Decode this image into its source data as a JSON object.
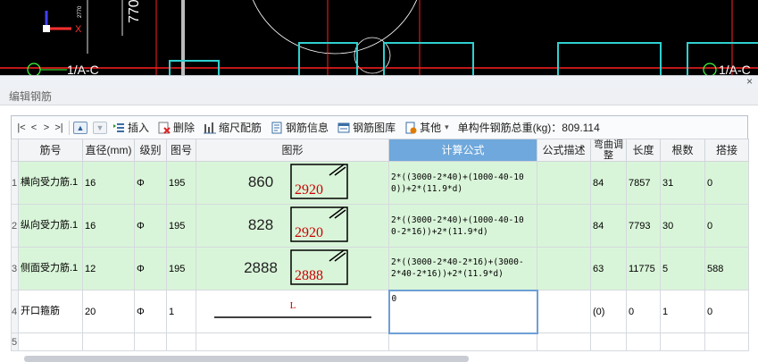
{
  "cad": {
    "axis_label": "1/A-C",
    "axis_label_right": "1/A-C",
    "dim_text": "770",
    "dim_text_small": "2770",
    "x_axis": "X"
  },
  "panel": {
    "title": "编辑钢筋",
    "close": "×"
  },
  "toolbar": {
    "nav": [
      "|<",
      "<",
      ">",
      ">|"
    ],
    "insert": "插入",
    "delete": "删除",
    "scale": "缩尺配筋",
    "info": "钢筋信息",
    "library": "钢筋图库",
    "other": "其他",
    "other_arrow": "▾",
    "total_label": "单构件钢筋总重(kg)：809.114"
  },
  "table": {
    "headers": [
      "",
      "筋号",
      "直径(mm)",
      "级别",
      "图号",
      "图形",
      "计算公式",
      "公式描述",
      "弯曲调整",
      "长度",
      "根数",
      "搭接"
    ],
    "rows": [
      {
        "idx": "1",
        "name": "横向受力筋.1",
        "diameter": "16",
        "grade": "Φ",
        "fig": "195",
        "shape_a": "860",
        "shape_b": "2920",
        "formula": "2*((3000-2*40)+(1000-40-10 0))+2*(11.9*d)",
        "desc": "",
        "bend": "84",
        "length": "7857",
        "count": "31",
        "lap": "0"
      },
      {
        "idx": "2",
        "name": "纵向受力筋.1",
        "diameter": "16",
        "grade": "Φ",
        "fig": "195",
        "shape_a": "828",
        "shape_b": "2920",
        "formula": "2*((3000-2*40)+(1000-40-10 0-2*16))+2*(11.9*d)",
        "desc": "",
        "bend": "84",
        "length": "7793",
        "count": "30",
        "lap": "0"
      },
      {
        "idx": "3",
        "name": "侧面受力筋.1",
        "diameter": "12",
        "grade": "Φ",
        "fig": "195",
        "shape_a": "2888",
        "shape_b": "2888",
        "formula": "2*((3000-2*40-2*16)+(3000-2*40-2*16))+2*(11.9*d)",
        "desc": "",
        "bend": "63",
        "length": "11775",
        "count": "5",
        "lap": "588"
      },
      {
        "idx": "4",
        "name": "开口箍筋",
        "diameter": "20",
        "grade": "Φ",
        "fig": "1",
        "shape_a": "L",
        "shape_b": "",
        "formula": "0",
        "desc": "",
        "bend": "(0)",
        "length": "0",
        "count": "1",
        "lap": "0"
      },
      {
        "idx": "5",
        "name": "",
        "diameter": "",
        "grade": "",
        "fig": "",
        "shape_a": "",
        "shape_b": "",
        "formula": "",
        "desc": "",
        "bend": "",
        "length": "",
        "count": "",
        "lap": ""
      }
    ]
  },
  "colors": {
    "cad_bg": "#000000",
    "row_green": "#d9f5d9",
    "active_header": "#6fa8dc",
    "shape_red": "#cc0000"
  }
}
